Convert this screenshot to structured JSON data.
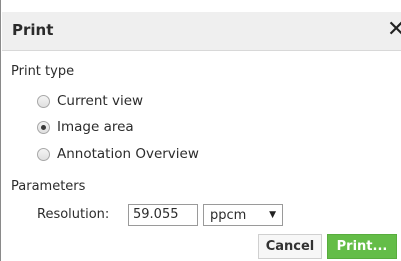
{
  "dialog": {
    "title": "Print",
    "close_symbol": "✕"
  },
  "print_type": {
    "label": "Print type",
    "options": [
      {
        "label": "Current view",
        "selected": false
      },
      {
        "label": "Image area",
        "selected": true
      },
      {
        "label": "Annotation Overview",
        "selected": false
      }
    ]
  },
  "parameters": {
    "label": "Parameters",
    "resolution_label": "Resolution:",
    "resolution_value": "59.055",
    "unit_selected": "ppcm"
  },
  "buttons": {
    "cancel": "Cancel",
    "print": "Print..."
  },
  "colors": {
    "print_button": "#64bd48",
    "titlebar": "#efefef"
  }
}
